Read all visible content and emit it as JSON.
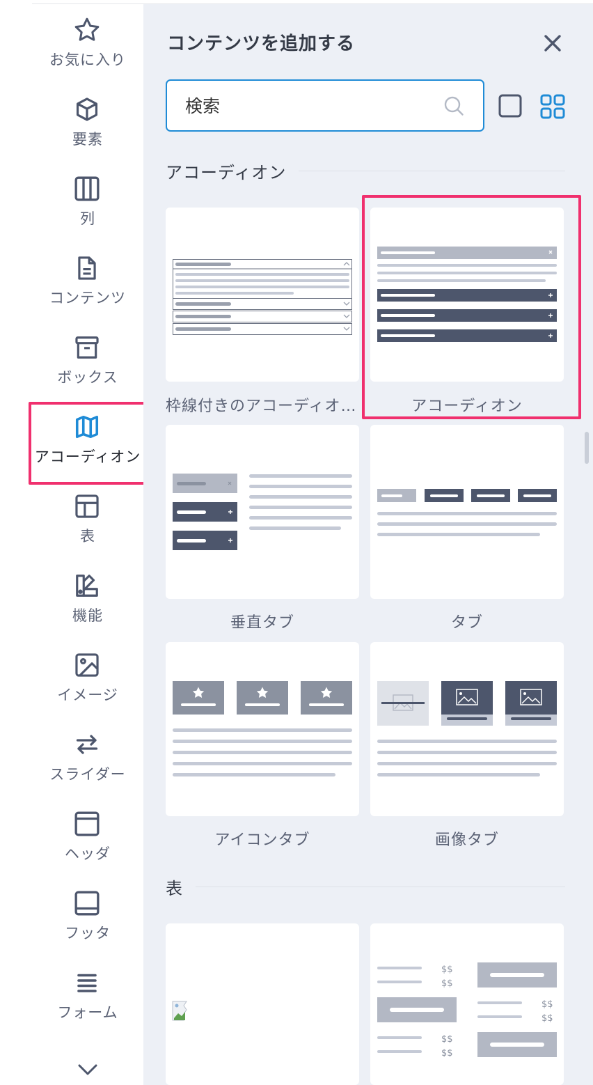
{
  "sidebar": {
    "items": [
      {
        "label": "お気に入り",
        "icon": "star-icon"
      },
      {
        "label": "要素",
        "icon": "cube-icon"
      },
      {
        "label": "列",
        "icon": "columns-icon"
      },
      {
        "label": "コンテンツ",
        "icon": "document-icon"
      },
      {
        "label": "ボックス",
        "icon": "archive-box-icon"
      },
      {
        "label": "アコーディオン",
        "icon": "map-icon",
        "active": true
      },
      {
        "label": "表",
        "icon": "table-layout-icon"
      },
      {
        "label": "機能",
        "icon": "swatch-icon"
      },
      {
        "label": "イメージ",
        "icon": "image-icon"
      },
      {
        "label": "スライダー",
        "icon": "arrows-swap-icon"
      },
      {
        "label": "ヘッダ",
        "icon": "header-icon"
      },
      {
        "label": "フッタ",
        "icon": "footer-icon"
      },
      {
        "label": "フォーム",
        "icon": "list-lines-icon"
      }
    ],
    "more_icon": "chevron-down-icon"
  },
  "panel": {
    "title": "コンテンツを追加する",
    "close_icon": "close-icon",
    "search": {
      "placeholder": "検索",
      "icon": "search-icon"
    },
    "view_icons": [
      "single-view-icon",
      "grid-view-icon"
    ],
    "sections": [
      {
        "heading": "アコーディオン",
        "cards": [
          {
            "label": "枠線付きのアコーディオ…"
          },
          {
            "label": "アコーディオン"
          },
          {
            "label": "垂直タブ"
          },
          {
            "label": "タブ"
          },
          {
            "label": "アイコンタブ"
          },
          {
            "label": "画像タブ"
          }
        ]
      },
      {
        "heading": "表",
        "cards": [
          {
            "label": ""
          },
          {
            "label": "",
            "price_marks": "$$"
          }
        ]
      }
    ]
  },
  "colors": {
    "accent": "#1f8bd6",
    "highlight": "#f0306e",
    "panel_bg": "#edf0f6",
    "dark_bar": "#4d566c",
    "light_bar": "#c5cad6"
  }
}
